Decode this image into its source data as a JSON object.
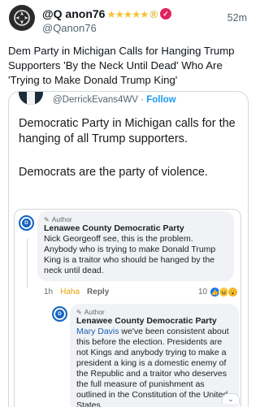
{
  "post": {
    "name": "@Q anon76",
    "stars": "★★★★★",
    "registered_mark": "®",
    "handle": "@Qanon76",
    "time": "52m",
    "headline": "Dem Party in Michigan Calls for Hanging Trump Supporters 'By the Neck Until Dead' Who Are 'Trying to Make Donald Trump King'"
  },
  "embedded_tweet": {
    "handle": "@DerrickEvans4WV",
    "separator": " · ",
    "follow_label": "Follow",
    "text_1": "Democratic Party in Michigan calls for the hanging of all Trump supporters.",
    "text_2": "Democrats are the party of violence."
  },
  "facebook": {
    "comment_1": {
      "author_label": "Author",
      "page_name": "Lenawee County Democratic Party",
      "text": "Nick Georgeoff see, this is the problem. Anybody who is trying to make Donald Trump King is a traitor who should be hanged by the neck until dead.",
      "time": "1h",
      "haha_label": "Haha",
      "reply_label": "Reply",
      "reaction_count": "10"
    },
    "comment_2": {
      "author_label": "Author",
      "page_name": "Lenawee County Democratic Party",
      "mention": "Mary Davis",
      "text": " we've been consistent about this before the election. Presidents are not Kings and anybody trying to make a president a king is a domestic enemy of the Republic and a traitor who deserves the full measure of punishment as outlined in the Constitution of the United States"
    }
  },
  "icons": {
    "avatar": "q-anon-avatar-icon",
    "verified": "verified-badge-icon",
    "expand": "chevron-down-icon"
  },
  "colors": {
    "stars": "#f4c430",
    "verified": "#e0245e",
    "twitter_blue": "#1d9bf0",
    "facebook_blue": "#1565c0",
    "haha": "#e6a500"
  }
}
